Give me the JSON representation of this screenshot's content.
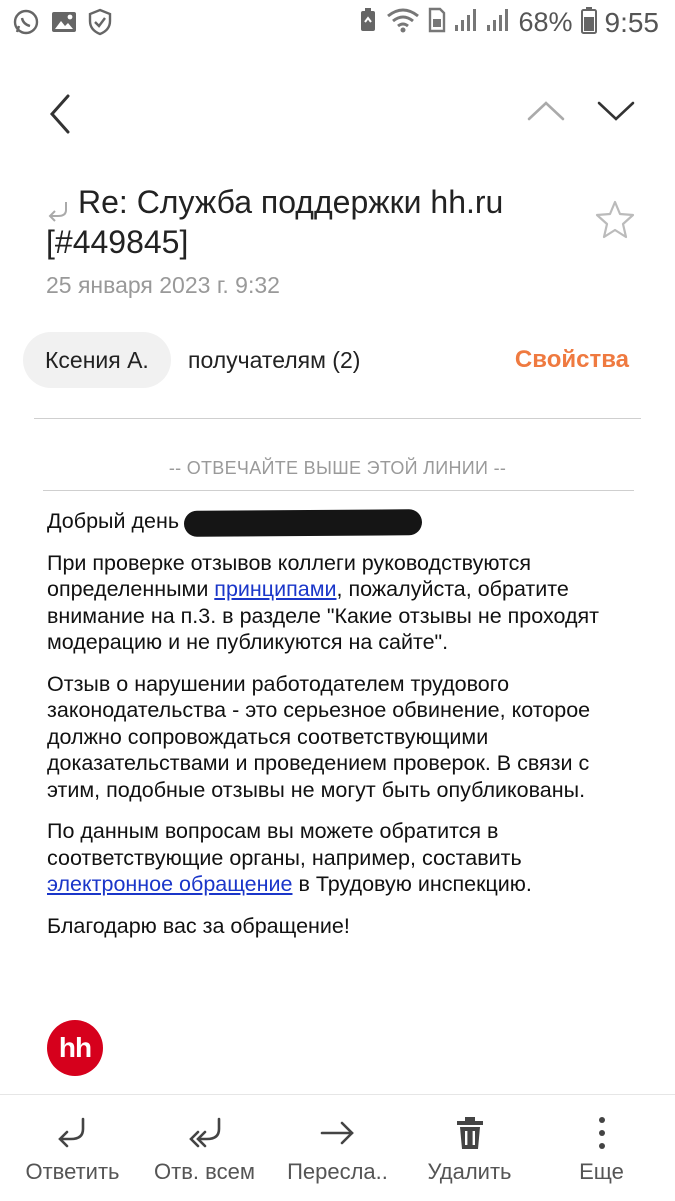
{
  "status_bar": {
    "battery_percent": "68%",
    "time": "9:55",
    "left_icons": [
      "whatsapp-icon",
      "gallery-icon",
      "shield-icon"
    ],
    "right_icons": [
      "recycle-icon",
      "wifi-icon",
      "sim-icon",
      "signal-icon",
      "signal-icon",
      "battery-icon"
    ]
  },
  "header": {
    "subject": "Re: Служба поддержки hh.ru [#449845]",
    "date": "25 января 2023 г.  9:32"
  },
  "sender": {
    "name": "Ксения А.",
    "recipients": "получателям (2)",
    "properties_label": "Свойства"
  },
  "message": {
    "reply_line": "-- ОТВЕЧАЙТЕ ВЫШЕ ЭТОЙ ЛИНИИ --",
    "greeting": "Добрый день",
    "p1_before": "При проверке отзывов коллеги руководствуются определенными ",
    "p1_link": "принципами",
    "p1_after": ", пожалуйста, обратите внимание на п.3. в разделе \"Какие отзывы не проходят модерацию и не публикуются на сайте\".",
    "p2": "Отзыв о нарушении работодателем трудового законодательства - это серьезное обвинение, которое должно сопровождаться соответствующими доказательствами и проведением проверок. В связи с этим, подобные отзывы не могут быть опубликованы.",
    "p3_before": "По данным вопросам вы можете обратится в соответствующие органы, например, составить ",
    "p3_link": "электронное обращение",
    "p3_after": " в Трудовую инспекцию.",
    "closing": "Благодарю вас за обращение!",
    "logo_text": "hh"
  },
  "toolbar": {
    "reply": "Ответить",
    "reply_all": "Отв. всем",
    "forward": "Пересла..",
    "delete": "Удалить",
    "more": "Еще"
  },
  "colors": {
    "accent": "#ef7a40",
    "link": "#1a36c9",
    "logo": "#d6001c"
  }
}
